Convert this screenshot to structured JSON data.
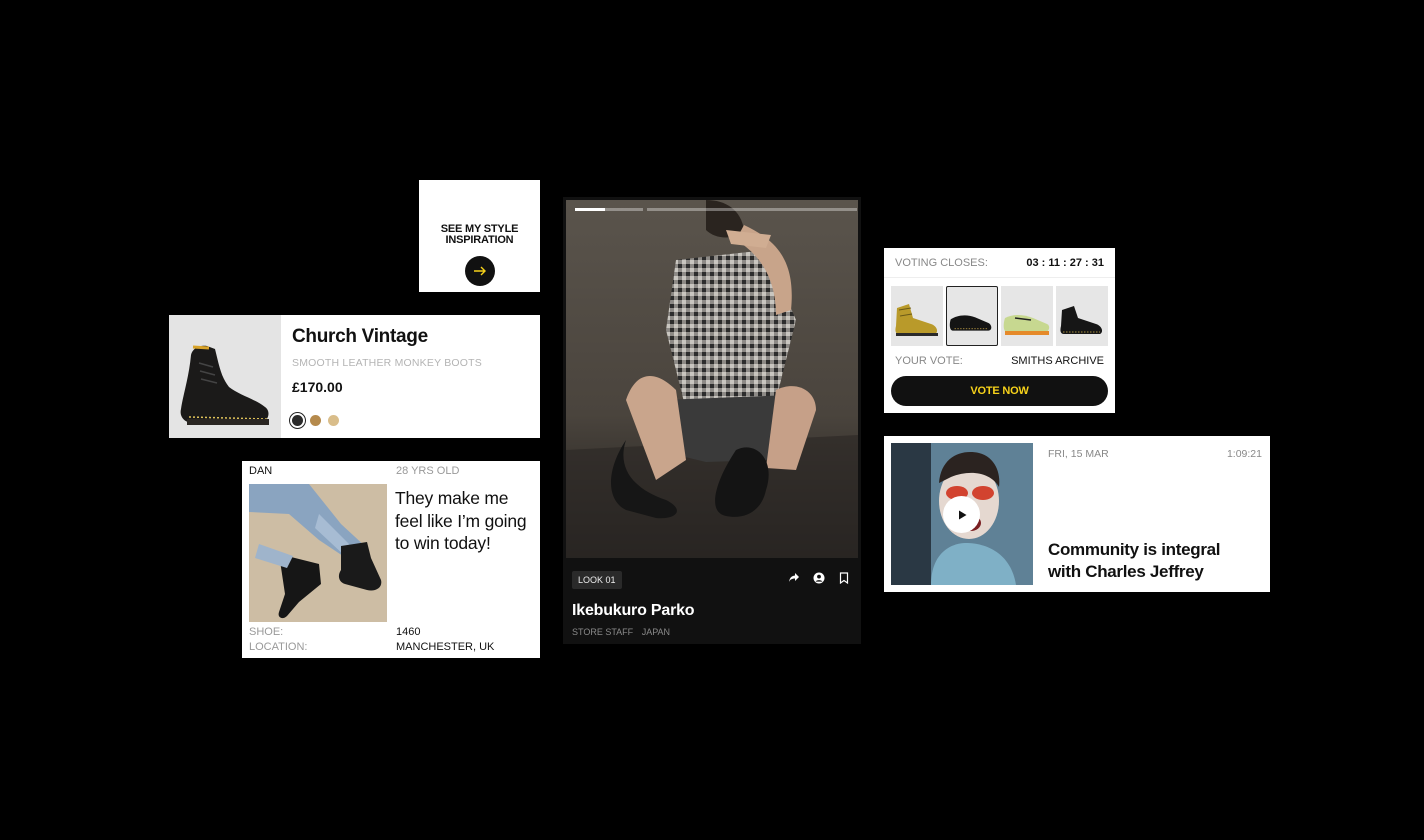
{
  "style_inspiration": {
    "label": "SEE MY STYLE INSPIRATION",
    "arrow_icon": "arrow-right-icon",
    "accent": "#f7d21a"
  },
  "product": {
    "name": "Church Vintage",
    "subtitle": "SMOOTH LEATHER MONKEY BOOTS",
    "price": "£170.00",
    "swatches": [
      {
        "name": "black",
        "color": "#2b2b2b",
        "selected": true
      },
      {
        "name": "tan",
        "color": "#b58a4c",
        "selected": false
      },
      {
        "name": "sand",
        "color": "#d9bd8a",
        "selected": false
      }
    ]
  },
  "testimonial": {
    "name": "DAN",
    "age": "28 YRS OLD",
    "quote": "They make me feel like I’m going to win today!",
    "shoe_label": "SHOE:",
    "shoe_value": "1460",
    "location_label": "LOCATION:",
    "location_value": "MANCHESTER, UK"
  },
  "look": {
    "tag": "LOOK 01",
    "title": "Ikebukuro Parko",
    "role": "STORE STAFF",
    "country": "JAPAN",
    "progress_segments": [
      1,
      0
    ],
    "actions": [
      "share-icon",
      "user-icon",
      "bookmark-icon"
    ]
  },
  "vote": {
    "closes_label": "VOTING CLOSES:",
    "countdown": "03 : 11 : 27 : 31",
    "your_vote_label": "YOUR VOTE:",
    "your_vote_value": "SMITHS ARCHIVE",
    "button": "VOTE NOW",
    "selected_index": 1
  },
  "video": {
    "date": "FRI, 15 MAR",
    "duration": "1:09:21",
    "title": "Community is integral with Charles Jeffrey",
    "play_icon": "play-icon"
  }
}
